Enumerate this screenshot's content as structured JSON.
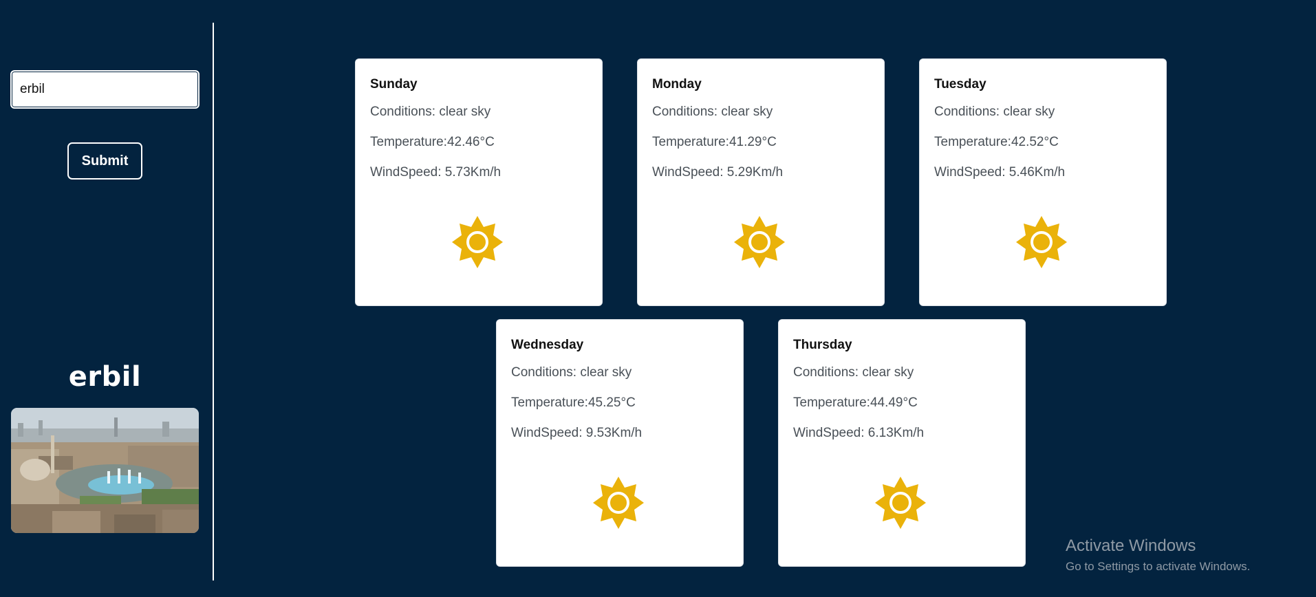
{
  "sidebar": {
    "search_value": "erbil",
    "submit_label": "Submit",
    "city_name": "erbil",
    "image_icon": "city-photo"
  },
  "forecast": [
    {
      "day": "Sunday",
      "conditions": "Conditions: clear sky",
      "temperature": "Temperature:42.46°C",
      "wind": "WindSpeed: 5.73Km/h",
      "icon": "sun-icon"
    },
    {
      "day": "Monday",
      "conditions": "Conditions: clear sky",
      "temperature": "Temperature:41.29°C",
      "wind": "WindSpeed: 5.29Km/h",
      "icon": "sun-icon"
    },
    {
      "day": "Tuesday",
      "conditions": "Conditions: clear sky",
      "temperature": "Temperature:42.52°C",
      "wind": "WindSpeed: 5.46Km/h",
      "icon": "sun-icon"
    },
    {
      "day": "Wednesday",
      "conditions": "Conditions: clear sky",
      "temperature": "Temperature:45.25°C",
      "wind": "WindSpeed: 9.53Km/h",
      "icon": "sun-icon"
    },
    {
      "day": "Thursday",
      "conditions": "Conditions: clear sky",
      "temperature": "Temperature:44.49°C",
      "wind": "WindSpeed: 6.13Km/h",
      "icon": "sun-icon"
    }
  ],
  "watermark": {
    "title": "Activate Windows",
    "subtitle": "Go to Settings to activate Windows."
  },
  "colors": {
    "background": "#03233f",
    "card": "#ffffff",
    "sun": "#eab20a",
    "text_muted": "#495057"
  }
}
